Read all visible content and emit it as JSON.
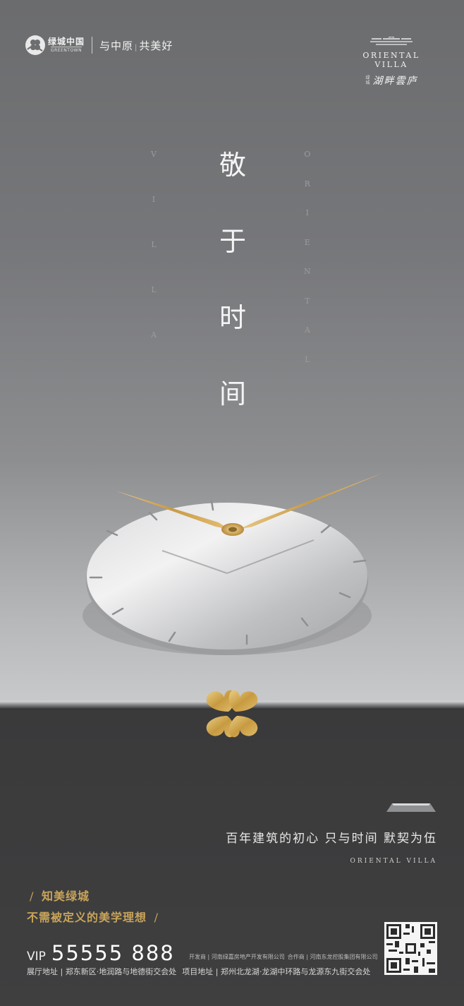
{
  "header": {
    "brand_cn": "绿城中国",
    "brand_en": "GREENTOWN",
    "slogan_part1": "与中原",
    "slogan_sep": "|",
    "slogan_part2": "共美好",
    "project_en": "ORIENTAL VILLA",
    "project_small": "绿城",
    "project_cn": "湖畔雲庐"
  },
  "hero": {
    "title_chars": [
      "敬",
      "于",
      "时",
      "间"
    ],
    "left_letters": [
      "V",
      "I",
      "L",
      "L",
      "A"
    ],
    "right_letters": [
      "O",
      "R",
      "I",
      "E",
      "N",
      "T",
      "A",
      "L"
    ]
  },
  "tagline": {
    "cn": "百年建筑的初心  只与时间  默契为伍",
    "en": "ORIENTAL VILLA"
  },
  "slogan_block": {
    "slash": "/",
    "line1": "知美绿城",
    "line2": "不需被定义的美学理想"
  },
  "contact": {
    "vip_label": "VIP",
    "vip_number": "55555 888",
    "developer": "开发商 | 河南绿嘉房地产开发有限公司",
    "partner": "合作商 | 河南东龙控股集团有限公司",
    "showroom": "展厅地址 | 郑东新区·地润路与地德街交会处",
    "project_addr": "项目地址 | 郑州北龙湖·龙湖中环路与龙源东九街交会处"
  },
  "icons": {
    "brand_logo": "greentown-flower-icon",
    "project_logo": "oriental-villa-roof-icon",
    "clock": "clock-illustration",
    "clover": "golden-clover-icon",
    "qr": "qr-code-icon"
  },
  "colors": {
    "gold": "#c9a45a",
    "background_top": "#6b6c6e",
    "floor": "#3a3a3b"
  }
}
